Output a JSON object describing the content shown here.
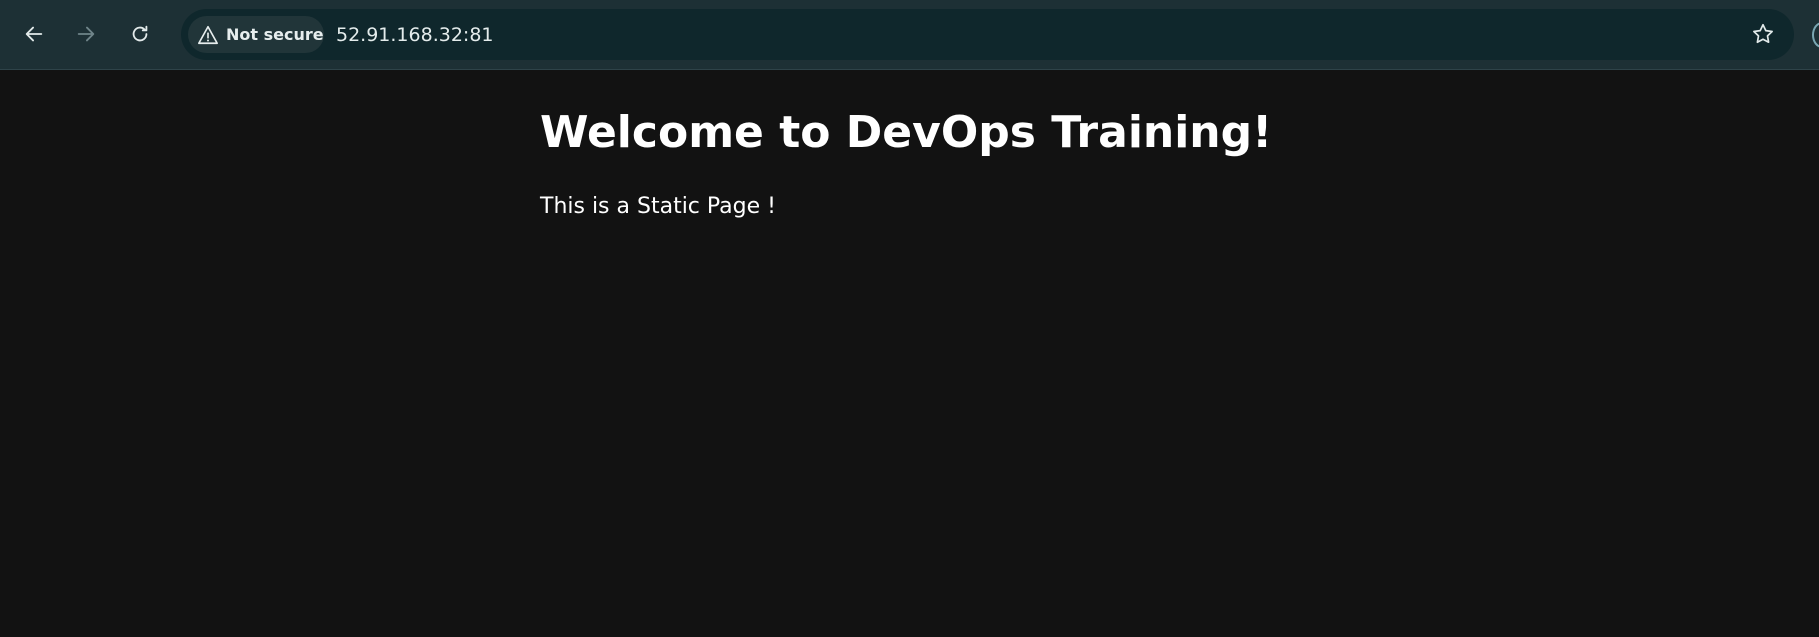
{
  "browser": {
    "security_label": "Not secure",
    "url": "52.91.168.32:81",
    "icons": {
      "back": "arrow-left-icon",
      "forward": "arrow-right-icon",
      "reload": "reload-icon",
      "security": "warning-triangle-icon",
      "bookmark": "star-icon"
    }
  },
  "page": {
    "heading": "Welcome to DevOps Training!",
    "text": "This is a Static Page !"
  },
  "colors": {
    "toolbar": "#1d3035",
    "omnibox": "#0f272c",
    "page_background": "#121212",
    "text": "#ffffff"
  }
}
